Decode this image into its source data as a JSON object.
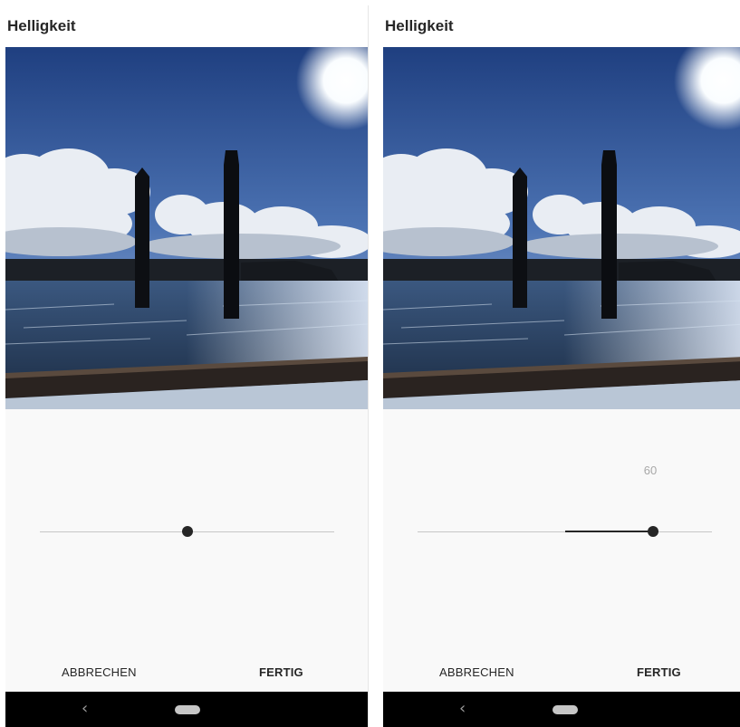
{
  "screens": [
    {
      "title": "Helligkeit",
      "slider": {
        "value": 0,
        "min": -100,
        "max": 100,
        "value_label": ""
      },
      "actions": {
        "cancel_label": "ABBRECHEN",
        "done_label": "FERTIG"
      },
      "navbar": {
        "back_icon": "‹",
        "home_icon": "home-pill"
      }
    },
    {
      "title": "Helligkeit",
      "slider": {
        "value": 60,
        "min": -100,
        "max": 100,
        "value_label": "60"
      },
      "actions": {
        "cancel_label": "ABBRECHEN",
        "done_label": "FERTIG"
      },
      "navbar": {
        "back_icon": "‹",
        "home_icon": "home-pill"
      }
    }
  ],
  "colors": {
    "accent": "#262626",
    "track": "#c7c7c7",
    "background": "#f9f9f9"
  }
}
